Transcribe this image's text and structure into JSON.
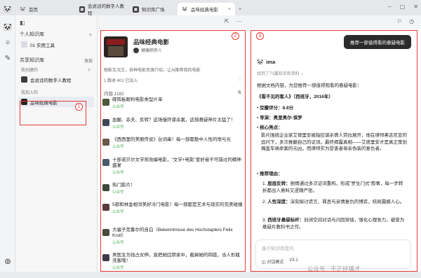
{
  "tabs": [
    {
      "label": "首页",
      "icon": "panda-icon"
    },
    {
      "label": "会说话的数字人教程",
      "icon": "doc-icon"
    },
    {
      "label": "知识库广场",
      "icon": "doc-icon"
    },
    {
      "label": "品味经典电影",
      "icon": "panda-icon"
    }
  ],
  "sidebar": {
    "personal_heading": "个人知识库",
    "personal_items": [
      "01 实用工具"
    ],
    "shared_heading": "共享知识库",
    "shared_action": "发现",
    "created_group": "我创建的",
    "created_items": [
      "会说话的数字人教程"
    ],
    "joined_group": "我加入的",
    "joined_items": [
      "品味经典电影"
    ]
  },
  "middle": {
    "title": "品味经典电影",
    "owner": "健康胖胖人",
    "desc": "观影又况文，各种电影资源介绍，让AI推荐我的电影",
    "stats": "1 数收  401 已加入",
    "count_label": "内容 1182",
    "items": [
      {
        "title": "碟阵板眼利电影类型片单",
        "src": "公众号"
      },
      {
        "title": "血腥、杀夫、反转？这场慢炸谍杀案，这部悬疑神片太猛了！",
        "src": "公众号"
      },
      {
        "title": "《西西里的美丽传说》台词串！每一部都散中人性的恨与光",
        "src": "公众号"
      },
      {
        "title": "十部诺贝尔文学奖改编电影，\"文学+电影\"爱好者不可错过的精神盛宴",
        "src": "公众号"
      },
      {
        "title": "热门影片！",
        "src": "公众号"
      },
      {
        "title": "5部和林金相邻美好冷门电影！每一部都是艺术与现实的完美碰撞",
        "src": "公众号"
      },
      {
        "title": "大骗子克鲁尔的自白（Bekenntnisse des Hochstaplers Felix Krull）",
        "src": "公众号"
      },
      {
        "title": "男医生为钱占女伸，竟把她囚禁家中，截掉她的四肢，当人形瓶洗客哦！",
        "src": "公众号"
      }
    ]
  },
  "right": {
    "ask_bubble": "推荐一部值得看的悬疑电影",
    "ai_name": "ima",
    "found": "找到了71篇知识库资料",
    "intro": "根据文档内容，为您推荐一部值得观看的悬疑电影：",
    "movie": "《看不见的客人》（西班牙，2016年）",
    "rating_label": "豆瓣评分：",
    "rating": "8.8分",
    "director_label": "导演：",
    "director": "奥里奥尔·保罗",
    "core_label": "核心亮点：",
    "core_text": "影片围绕企业家艾德里安被指控谋杀情人劳拉展开，他在律师弗吉尼亚的追问下，多次推翻自己的证词。最终揭露真相——艾德里安才是真正策划掩盖车祸命案的元凶，而律师实为受害者母亲伪装的复仇者。",
    "reason_label": "推荐理由：",
    "reasons": [
      {
        "k": "层层反转：",
        "v": "剧情通过多次证词重构，形成\"罗生门式\"叙事，每一步转折都出人意料又逻辑严密。"
      },
      {
        "k": "人性深度：",
        "v": "深刻探讨谎言、罪恶与亲情复仇的博弈，结局震撼人心。"
      },
      {
        "k": "西班牙悬疑标杆：",
        "v": "封闭空间对话与闪回穿插，强化心理张力，被誉为悬疑片教科书之作。"
      }
    ],
    "input_placeholder": "基于知识库提问",
    "mode": "对话模式",
    "version": "V3.1",
    "watermark": "公众号 · 不正经猿才"
  },
  "annotations": [
    "1",
    "2",
    "3"
  ]
}
